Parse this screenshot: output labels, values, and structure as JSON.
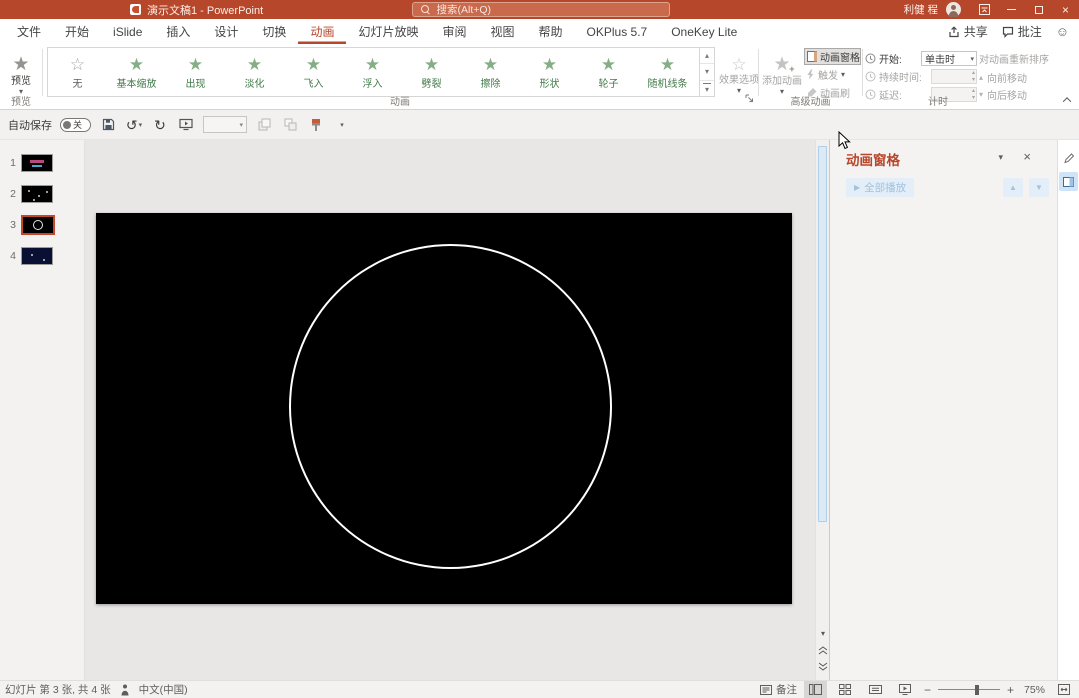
{
  "title_bar": {
    "app_title": "演示文稿1 - PowerPoint",
    "search_placeholder": "搜索(Alt+Q)",
    "user_name": "利健 程"
  },
  "tab_bar": {
    "tabs": [
      {
        "label": "文件"
      },
      {
        "label": "开始"
      },
      {
        "label": "iSlide"
      },
      {
        "label": "插入"
      },
      {
        "label": "设计"
      },
      {
        "label": "切换"
      },
      {
        "label": "动画"
      },
      {
        "label": "幻灯片放映"
      },
      {
        "label": "审阅"
      },
      {
        "label": "视图"
      },
      {
        "label": "帮助"
      },
      {
        "label": "OKPlus 5.7"
      },
      {
        "label": "OneKey Lite"
      }
    ],
    "active_tab": "动画",
    "share": "共享",
    "comments": "批注"
  },
  "ribbon": {
    "preview_button": "预览",
    "preview_group": "预览",
    "gallery": [
      {
        "label": "无",
        "category": "none"
      },
      {
        "label": "基本缩放",
        "category": "entrance"
      },
      {
        "label": "出现",
        "category": "entrance"
      },
      {
        "label": "淡化",
        "category": "entrance"
      },
      {
        "label": "飞入",
        "category": "entrance"
      },
      {
        "label": "浮入",
        "category": "entrance"
      },
      {
        "label": "劈裂",
        "category": "entrance"
      },
      {
        "label": "擦除",
        "category": "entrance"
      },
      {
        "label": "形状",
        "category": "entrance"
      },
      {
        "label": "轮子",
        "category": "entrance"
      },
      {
        "label": "随机线条",
        "category": "entrance"
      }
    ],
    "animation_group": "动画",
    "effect_options": "效果选项",
    "add_animation": "添加动画",
    "animation_pane_toggle": "动画窗格",
    "trigger": "触发",
    "animation_painter": "动画刷",
    "advanced_group": "高级动画",
    "timing": {
      "start_label": "开始:",
      "start_value": "单击时",
      "duration_label": "持续时间:",
      "delay_label": "延迟:",
      "reorder_label": "对动画重新排序",
      "move_earlier": "向前移动",
      "move_later": "向后移动",
      "group_label": "计时"
    }
  },
  "quick_access": {
    "autosave_label": "自动保存",
    "autosave_state": "关"
  },
  "slides_panel": {
    "slides": [
      {
        "number": "1"
      },
      {
        "number": "2"
      },
      {
        "number": "3"
      },
      {
        "number": "4"
      }
    ],
    "selected": "3"
  },
  "animation_pane": {
    "title": "动画窗格",
    "play_all": "全部播放"
  },
  "status_bar": {
    "slide_position": "幻灯片 第 3 张, 共 4 张",
    "language": "中文(中国)",
    "notes": "备注",
    "zoom": "75%"
  },
  "icons": {
    "star": "★",
    "star_outline": "☆",
    "dropdown": "▾",
    "chevron_up": "▴",
    "chevron_down": "▾",
    "close": "×",
    "undo": "↺",
    "redo": "↻",
    "play": "▶",
    "arrow_up": "▲",
    "arrow_down": "▼",
    "minus": "−",
    "plus": "+",
    "smiley": "☺"
  },
  "colors": {
    "title_bar": "#B7472A",
    "accent": "#B7472A",
    "entrance_green": "#417A49",
    "disabled": "#A6A4A2"
  }
}
